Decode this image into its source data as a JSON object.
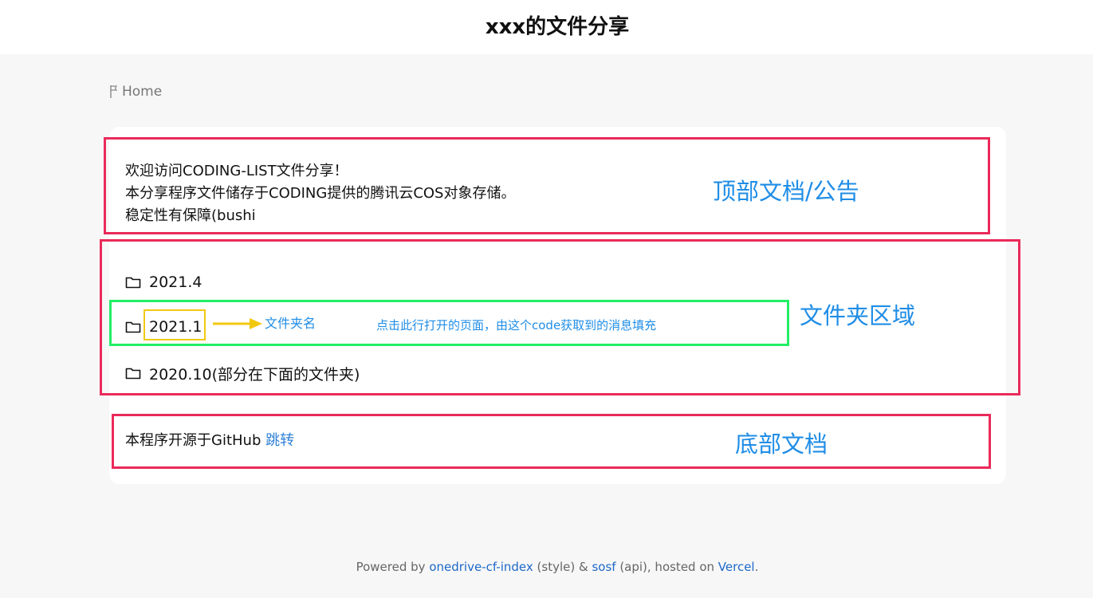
{
  "header": {
    "title": "xxx的文件分享"
  },
  "breadcrumb": {
    "home_label": "Home"
  },
  "readme_top": {
    "lines": [
      "欢迎访问CODING-LIST文件分享！",
      "本分享程序文件储存于CODING提供的腾讯云COS对象存储。",
      "稳定性有保障(bushi"
    ]
  },
  "folders": [
    {
      "name": "2021.4"
    },
    {
      "name": "2021.1"
    },
    {
      "name": "2020.10(部分在下面的文件夹)"
    }
  ],
  "readme_bottom": {
    "text": "本程序开源于GitHub ",
    "link_label": "跳转"
  },
  "footer": {
    "powered_by": "Powered by ",
    "link1": "onedrive-cf-index",
    "text_style": " (style) & ",
    "link2": "sosf",
    "text_api": " (api), hosted on ",
    "link3": "Vercel",
    "period": "."
  },
  "annotations": {
    "top_doc": "顶部文档/公告",
    "folder_area": "文件夹区域",
    "folder_name": "文件夹名",
    "click_note": "点击此行打开的页面，由这个code获取到的消息填充",
    "bottom_doc": "底部文档"
  },
  "colors": {
    "annotation_red": "#ea2a5a",
    "annotation_green": "#22ee66",
    "annotation_yellow": "#f2c80f",
    "annotation_text_blue": "#1f8de6",
    "link_blue": "#2f80d6"
  },
  "icons": {
    "breadcrumb": "flag-icon",
    "folder": "folder-icon",
    "annotation_arrow": "arrow-right-icon"
  }
}
